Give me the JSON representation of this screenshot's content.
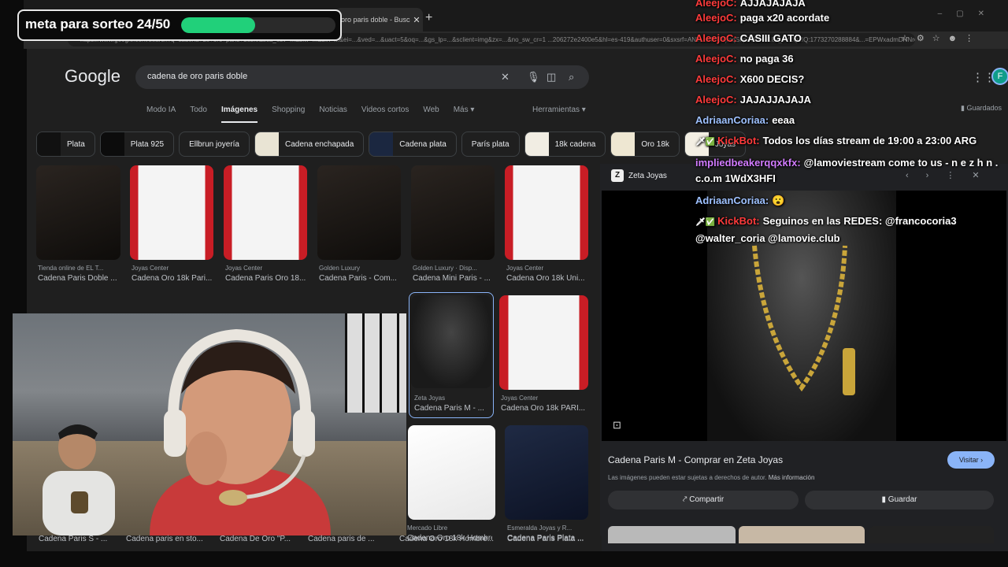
{
  "overlay": {
    "goal_label": "meta para sorteo 24/50",
    "goal_progress": 0.48,
    "goal_color": "#21d07a"
  },
  "browser": {
    "tab_title": "oro paris doble - Busca",
    "url": "https://www.google.com/search?q=cadena+de+oro+paris+doble&sca_esv=...&biw=...&bih=...&ei=...&ved=...&uact=5&oq=...&gs_lp=...&sclient=img&zx=...&no_sw_cr=1 ...206272e2400e5&hl=es-419&authuser=0&sxsrf=ANbL-n4EUYjmqSnpZoEIHd18x_eVZQ1IQ:1773270288884&...=EPWxadmDNNre1sQP..."
  },
  "google": {
    "logo": "Google",
    "query": "cadena de oro paris doble",
    "account_initial": "F",
    "nav_tabs": [
      {
        "label": "Modo IA",
        "active": false
      },
      {
        "label": "Todo",
        "active": false
      },
      {
        "label": "Imágenes",
        "active": true
      },
      {
        "label": "Shopping",
        "active": false
      },
      {
        "label": "Noticias",
        "active": false
      },
      {
        "label": "Videos cortos",
        "active": false
      },
      {
        "label": "Web",
        "active": false
      },
      {
        "label": "Más ▾",
        "active": false
      }
    ],
    "tools_label": "Herramientas ▾",
    "saved_label": "Guardados",
    "chips": [
      {
        "label": "Plata",
        "thumb": true,
        "color": "#111111"
      },
      {
        "label": "Plata 925",
        "thumb": true,
        "color": "#0c0c0c"
      },
      {
        "label": "Ellbrun joyería",
        "thumb": false
      },
      {
        "label": "Cadena enchapada",
        "thumb": true,
        "color": "#e9e4d4"
      },
      {
        "label": "Cadena plata",
        "thumb": true,
        "color": "#1b2740"
      },
      {
        "label": "París plata",
        "thumb": false
      },
      {
        "label": "18k cadena",
        "thumb": true,
        "color": "#f1ede3"
      },
      {
        "label": "Oro 18k",
        "thumb": true,
        "color": "#eee7d2"
      },
      {
        "label": "Joyas",
        "thumb": true,
        "color": "#f3efe3"
      }
    ],
    "results_row1": [
      {
        "source": "Tienda online de EL T...",
        "title": "Cadena Paris Doble ..."
      },
      {
        "source": "Joyas Center",
        "title": "Cadena Oro 18k Pari..."
      },
      {
        "source": "Joyas Center",
        "title": "Cadena Paris Oro 18..."
      },
      {
        "source": "Golden Luxury",
        "title": "Cadena Paris - Com..."
      },
      {
        "source": "Golden Luxury · Disp...",
        "title": "Cadena Mini Paris - ..."
      },
      {
        "source": "Joyas Center",
        "title": "Cadena Oro 18k Uni..."
      }
    ],
    "results_row2": [
      {
        "source": "Zeta Joyas",
        "title": "Cadena Paris M - ..."
      },
      {
        "source": "Joyas Center",
        "title": "Cadena Oro 18k PARI..."
      }
    ],
    "results_row3": [
      {
        "source": "Mercado Libre",
        "title": "Cadena Oro 18k Hombre..."
      },
      {
        "source": "Esmeralda Joyas y R...",
        "title": "Cadena Paris Plata ..."
      }
    ],
    "bottom_titles": [
      "Cadena Paris S - ...",
      "Cadena paris en sto...",
      "Cadena De Oro \"P...",
      "Cadena paris de ..."
    ],
    "preview": {
      "site": "Zeta Joyas",
      "title": "Cadena Paris M - Comprar en Zeta Joyas",
      "visit_label": "Visitar ›",
      "note": "Las imágenes pueden estar sujetas a derechos de autor.",
      "note_link": "Más información",
      "share_label": "Compartir",
      "save_label": "Guardar"
    }
  },
  "chat": [
    {
      "user": "AleejoC:",
      "text": "AJJAJAJAJA",
      "color": "#ff3b3b",
      "badges": ""
    },
    {
      "user": "AleejoC:",
      "text": "paga x20 acordate",
      "color": "#ff3b3b",
      "badges": ""
    },
    {
      "user": "AleejoC:",
      "text": "CASIII GATO",
      "color": "#ff3b3b",
      "badges": ""
    },
    {
      "user": "AleejoC:",
      "text": "no paga 36",
      "color": "#ff3b3b",
      "badges": ""
    },
    {
      "user": "AleejoC:",
      "text": "X600 DECIS?",
      "color": "#ff3b3b",
      "badges": ""
    },
    {
      "user": "AleejoC:",
      "text": "JAJAJJAJAJA",
      "color": "#ff3b3b",
      "badges": ""
    },
    {
      "user": "AdriaanCoriaa:",
      "text": "eeaa",
      "color": "#9ec1ff",
      "badges": ""
    },
    {
      "user": "KickBot:",
      "text": "Todos los días stream de 19:00 a 23:00 ARG",
      "color": "#ff3b3b",
      "badges": "🗡✅"
    },
    {
      "user": "impliedbeakerqqxkfx:",
      "text": "@lamoviestream come to us - n e z h n . c.o.m 1WdX3HFI",
      "color": "#d17bff",
      "badges": ""
    },
    {
      "user": "AdriaanCoriaa:",
      "text": "😮",
      "color": "#9ec1ff",
      "badges": ""
    },
    {
      "user": "KickBot:",
      "text": "Seguinos en las REDES: @francocoria3 @walter_coria @lamovie.club",
      "color": "#ff3b3b",
      "badges": "🗡✅"
    }
  ]
}
